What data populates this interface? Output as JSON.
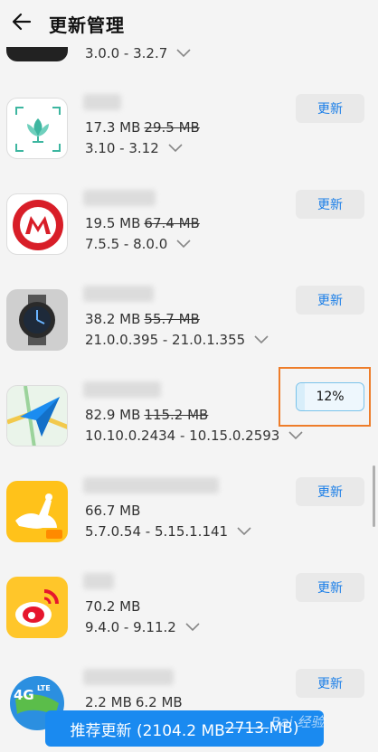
{
  "header": {
    "title": "更新管理"
  },
  "apps": [
    {
      "size": "",
      "old_size": "",
      "version": "3.0.0 - 3.2.7",
      "button": ""
    },
    {
      "size": "17.3 MB",
      "old_size": "29.5 MB",
      "version": "3.10 - 3.12",
      "button": "更新"
    },
    {
      "size": "19.5 MB",
      "old_size": "67.4 MB",
      "version": "7.5.5 - 8.0.0",
      "button": "更新"
    },
    {
      "size": "38.2 MB",
      "old_size": "55.7 MB",
      "version": "21.0.0.395 - 21.0.1.355",
      "button": "更新"
    },
    {
      "size": "82.9 MB",
      "old_size": "115.2 MB",
      "version": "10.10.0.2434 - 10.15.0.2593",
      "progress_text": "12%",
      "progress": 0.12
    },
    {
      "size": "66.7 MB",
      "old_size": "",
      "version": "5.7.0.54 - 5.15.1.141",
      "button": "更新"
    },
    {
      "size": "70.2 MB",
      "old_size": "",
      "version": "9.4.0 - 9.11.2",
      "button": "更新"
    },
    {
      "size": "2.2 MB",
      "old_size": "6.2 MB",
      "version": "",
      "button": "更新"
    }
  ],
  "footer": {
    "label": "推荐更新 (2104.2 MB ",
    "old": "2713.",
    "tail": " MB)"
  },
  "watermark": "Bai 经验",
  "colors": {
    "accent": "#1a8af0",
    "highlight": "#ee7d2a"
  }
}
